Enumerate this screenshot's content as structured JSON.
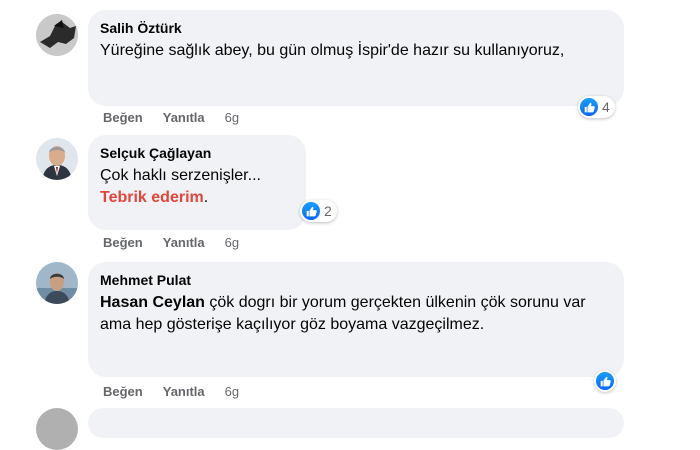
{
  "comments": [
    {
      "author": "Salih Öztürk",
      "text": "Yüreğine sağlık abey, bu gün olmuş İspir'de hazır su kullanıyoruz,",
      "reaction_count": "4",
      "actions": {
        "like": "Beğen",
        "reply": "Yanıtla",
        "time": "6g"
      }
    },
    {
      "author": "Selçuk Çağlayan",
      "line1": "Çok haklı serzenişler...",
      "mention": "Tebrik ederim",
      "after_mention": ".",
      "reaction_count": "2",
      "actions": {
        "like": "Beğen",
        "reply": "Yanıtla",
        "time": "6g"
      }
    },
    {
      "author": "Mehmet Pulat",
      "mention": "Hasan Ceylan",
      "text": " çök dogrı bir yorum gerçekten ülkenin çök sorunu var ama hep gösterişe kaçılıyor göz boyama vazgeçilmez.",
      "actions": {
        "like": "Beğen",
        "reply": "Yanıtla",
        "time": "6g"
      }
    }
  ],
  "colors": {
    "bubble": "#f0f2f5",
    "like_blue": "#0866ff",
    "mention_red": "#e0463b",
    "secondary_text": "#65676b"
  }
}
